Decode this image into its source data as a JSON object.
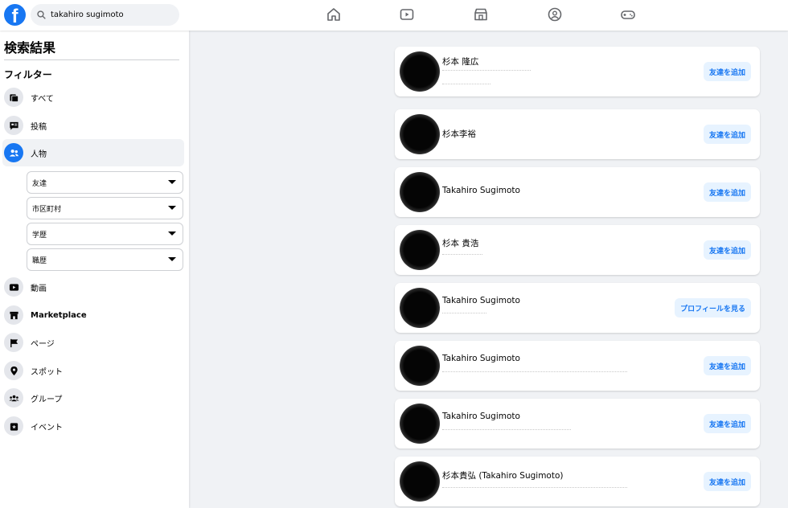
{
  "search": {
    "value": "takahiro sugimoto"
  },
  "nav": {
    "icons": [
      "home-icon",
      "video-icon",
      "marketplace-icon",
      "groups-icon",
      "gaming-icon"
    ]
  },
  "sidebar": {
    "title": "検索結果",
    "filter_title": "フィルター",
    "items": [
      {
        "label": "すべて",
        "icon": "feed-icon"
      },
      {
        "label": "投稿",
        "icon": "posts-icon"
      },
      {
        "label": "人物",
        "icon": "people-icon",
        "active": true
      },
      {
        "label": "動画",
        "icon": "video-icon"
      },
      {
        "label": "Marketplace",
        "icon": "marketplace-icon"
      },
      {
        "label": "ページ",
        "icon": "flag-icon"
      },
      {
        "label": "スポット",
        "icon": "location-pin-icon"
      },
      {
        "label": "グループ",
        "icon": "groups-icon"
      },
      {
        "label": "イベント",
        "icon": "event-icon"
      }
    ],
    "dropdowns": [
      "友達",
      "市区町村",
      "学歴",
      "職歴"
    ]
  },
  "results": [
    {
      "name": "杉本 隆広",
      "button": "友達を追加"
    },
    {
      "name": "杉本李裕",
      "button": "友達を追加"
    },
    {
      "name": "Takahiro Sugimoto",
      "button": "友達を追加"
    },
    {
      "name": "杉本 貴浩",
      "button": "友達を追加"
    },
    {
      "name": "Takahiro Sugimoto",
      "button": "プロフィールを見る"
    },
    {
      "name": "Takahiro Sugimoto",
      "button": "友達を追加"
    },
    {
      "name": "Takahiro Sugimoto",
      "button": "友達を追加"
    },
    {
      "name": "杉本貴弘 (Takahiro Sugimoto)",
      "button": "友達を追加"
    }
  ],
  "colors": {
    "accent": "#1877f2",
    "background": "#f0f2f5",
    "button_bg": "#e7f3ff"
  }
}
